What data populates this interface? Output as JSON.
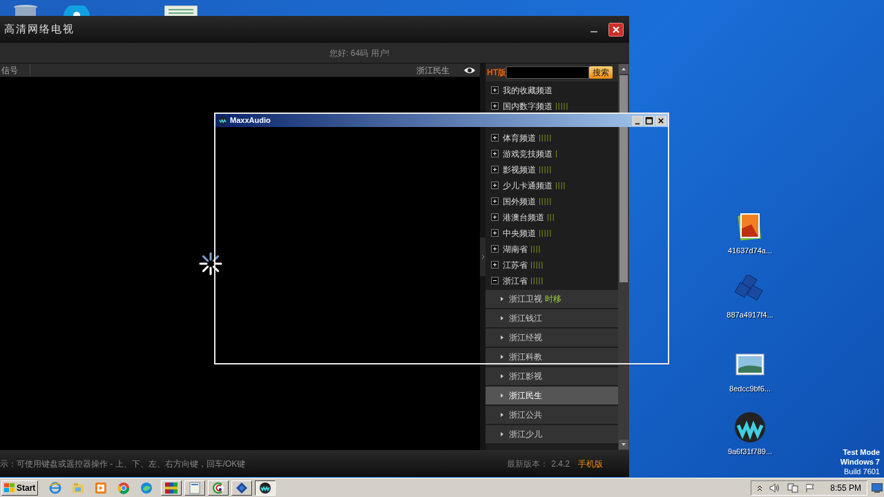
{
  "desktop": {
    "icons": [
      {
        "label": "41637d74a..."
      },
      {
        "label": "887a4917f4..."
      },
      {
        "label": "8edcc9bf6..."
      },
      {
        "label": "9a6f31f789..."
      }
    ],
    "os_notice": [
      "Test Mode",
      "Windows 7",
      "Build 7601"
    ]
  },
  "app": {
    "title": "高清网络电视",
    "greeting": "您好: 64码 用户!",
    "signal_label": "信号",
    "current_channel": "浙江民生",
    "search": {
      "badge": "HT版",
      "button": "搜索"
    },
    "categories": [
      {
        "label": "我的收藏频道",
        "expanded": false
      },
      {
        "label": "国内数字频道",
        "expanded": false,
        "bars": "|||||"
      },
      {
        "label": "体育频道",
        "expanded": false,
        "bars": "|||||"
      },
      {
        "label": "游戏竞技频道",
        "expanded": false,
        "bars": "|"
      },
      {
        "label": "影视频道",
        "expanded": false,
        "bars": "|||||"
      },
      {
        "label": "少儿卡通频道",
        "expanded": false,
        "bars": "||||"
      },
      {
        "label": "国外频道",
        "expanded": false,
        "bars": "|||||"
      },
      {
        "label": "港澳台频道",
        "expanded": false,
        "bars": "|||"
      },
      {
        "label": "中央频道",
        "expanded": false,
        "bars": "|||||"
      },
      {
        "label": "湖南省",
        "expanded": false,
        "bars": "||||"
      },
      {
        "label": "江苏省",
        "expanded": false,
        "bars": "|||||"
      },
      {
        "label": "浙江省",
        "expanded": true,
        "bars": "|||||",
        "children": [
          {
            "label": "浙江卫视",
            "tag": "时移",
            "selected": false
          },
          {
            "label": "浙江钱江",
            "selected": false
          },
          {
            "label": "浙江经视",
            "selected": false
          },
          {
            "label": "浙江科教",
            "selected": false
          },
          {
            "label": "浙江影视",
            "selected": false
          },
          {
            "label": "浙江民生",
            "selected": true
          },
          {
            "label": "浙江公共",
            "selected": false
          },
          {
            "label": "浙江少儿",
            "selected": false
          }
        ]
      }
    ],
    "footer": {
      "hint": "示：可使用键盘或遥控器操作 - 上、下、左、右方向键，回车/OK键",
      "version_label": "最新版本：",
      "version": "2.4.2",
      "mobile_link": "手机版"
    }
  },
  "dialog": {
    "title": "MaxxAudio"
  },
  "taskbar": {
    "start": "Start",
    "tasks": [
      {
        "selected": false
      },
      {
        "selected": false
      },
      {
        "selected": false
      },
      {
        "selected": false
      },
      {
        "selected": true
      }
    ],
    "clock": "8:55 PM"
  }
}
